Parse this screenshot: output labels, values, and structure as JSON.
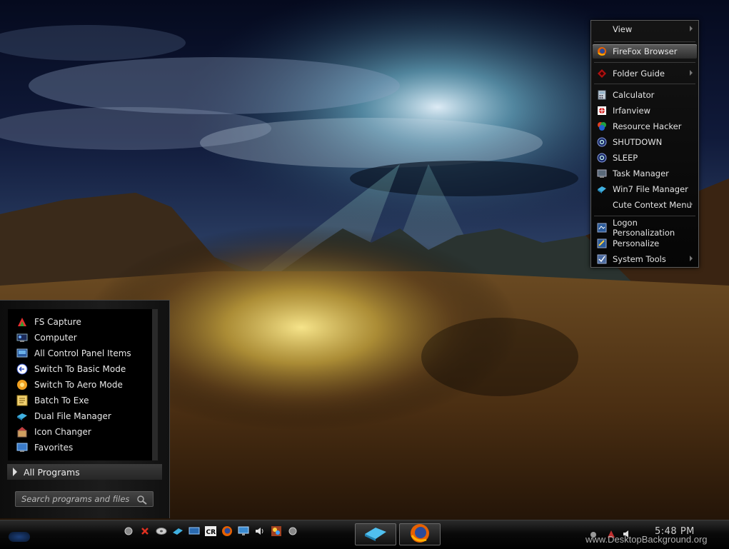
{
  "context_menu": {
    "items": [
      {
        "label": "View",
        "icon": "none",
        "submenu": true
      },
      {
        "label": "FireFox Browser",
        "icon": "firefox-icon",
        "submenu": false,
        "highlighted": true
      },
      {
        "label": "Folder Guide",
        "icon": "folder-guide-icon",
        "submenu": true
      },
      {
        "label": "Calculator",
        "icon": "calculator-icon",
        "submenu": false
      },
      {
        "label": "Irfanview",
        "icon": "irfanview-icon",
        "submenu": false
      },
      {
        "label": "Resource Hacker",
        "icon": "resource-hacker-icon",
        "submenu": false
      },
      {
        "label": "SHUTDOWN",
        "icon": "shutdown-icon",
        "submenu": false
      },
      {
        "label": "SLEEP",
        "icon": "sleep-icon",
        "submenu": false
      },
      {
        "label": "Task Manager",
        "icon": "task-manager-icon",
        "submenu": false
      },
      {
        "label": "Win7 File Manager",
        "icon": "file-manager-icon",
        "submenu": false
      },
      {
        "label": "Cute Context Menu",
        "icon": "none",
        "submenu": true
      },
      {
        "label": "Logon Personalization",
        "icon": "logon-icon",
        "submenu": false
      },
      {
        "label": "Personalize",
        "icon": "personalize-icon",
        "submenu": false
      },
      {
        "label": "System Tools",
        "icon": "system-tools-icon",
        "submenu": true
      }
    ]
  },
  "start_menu": {
    "items": [
      {
        "label": "FS Capture",
        "icon": "fs-capture-icon"
      },
      {
        "label": "Computer",
        "icon": "computer-icon"
      },
      {
        "label": "All Control Panel Items",
        "icon": "control-panel-icon"
      },
      {
        "label": "Switch To Basic Mode",
        "icon": "basic-mode-icon"
      },
      {
        "label": "Switch To Aero Mode",
        "icon": "aero-mode-icon"
      },
      {
        "label": "Batch To Exe",
        "icon": "batch-to-exe-icon"
      },
      {
        "label": "Dual File Manager",
        "icon": "dual-file-manager-icon"
      },
      {
        "label": "Icon Changer",
        "icon": "icon-changer-icon"
      },
      {
        "label": "Favorites",
        "icon": "favorites-icon"
      }
    ],
    "all_programs": "All Programs",
    "search_placeholder": "Search programs and files"
  },
  "taskbar": {
    "quick_launch": [
      "dot-icon",
      "close-x-icon",
      "disk-icon",
      "pen-icon",
      "monitor-icon",
      "cr-icon",
      "firefox-icon",
      "display-icon",
      "speaker-icon",
      "paint-icon",
      "dot-icon"
    ],
    "cr_label": "CR",
    "tasks": [
      "file-manager-icon",
      "firefox-icon"
    ],
    "clock": "5:48 PM"
  },
  "watermark": "www.DesktopBackground.org"
}
